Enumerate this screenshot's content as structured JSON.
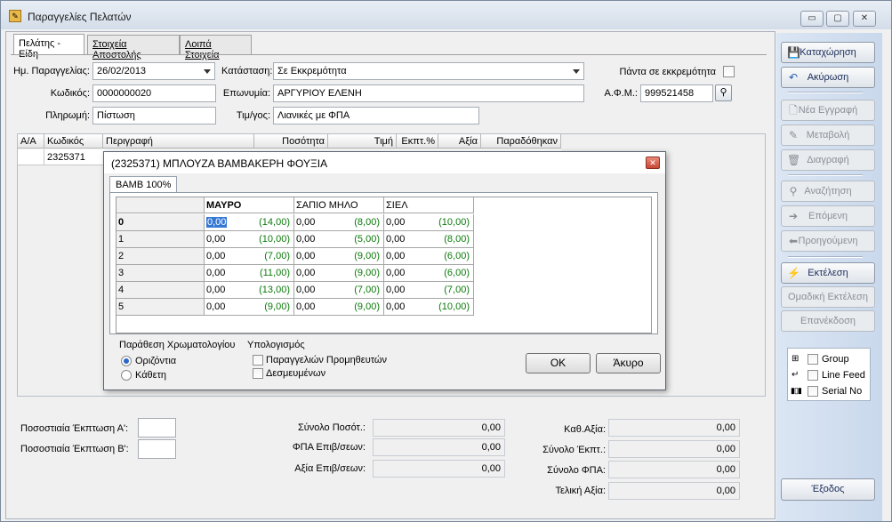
{
  "window": {
    "title": "Παραγγελίες Πελατών",
    "controls": [
      "▭",
      "▢",
      "✕"
    ]
  },
  "tabs": [
    {
      "label": "Πελάτης - Είδη"
    },
    {
      "label": "Στοιχεία Αποστολής"
    },
    {
      "label": "Λοιπά Στοιχεία"
    }
  ],
  "form": {
    "order_date_label": "Ημ. Παραγγελίας:",
    "order_date": "26/02/2013",
    "status_label": "Κατάσταση:",
    "status": "Σε Εκκρεμότητα",
    "always_pending_label": "Πάντα σε εκκρεμότητα",
    "code_label": "Κωδικός:",
    "code": "0000000020",
    "name_label": "Επωνυμία:",
    "name": "ΑΡΓΥΡΙΟΥ ΕΛΕΝΗ",
    "afm_label": "Α.Φ.Μ.:",
    "afm": "999521458",
    "payment_label": "Πληρωμή:",
    "payment": "Πίστωση",
    "pricelist_label": "Τιμ/γος:",
    "pricelist": "Λιανικές με ΦΠΑ"
  },
  "grid": {
    "columns": [
      "Α/Α",
      "Κωδικός",
      "Περιγραφή",
      "Ποσότητα",
      "Τιμή",
      "Εκπτ.%",
      "Αξία",
      "Παραδόθηκαν"
    ],
    "rows": [
      {
        "code": "2325371"
      }
    ]
  },
  "totals": {
    "disc_a_label": "Ποσοστιαία Έκπτωση  Α':",
    "disc_b_label": "Ποσοστιαία Έκπτωση  Β':",
    "sum_qty_label": "Σύνολο Ποσότ.:",
    "sum_qty": "0,00",
    "vat_charges_label": "ΦΠΑ Επιβ/σεων:",
    "vat_charges": "0,00",
    "value_charges_label": "Αξία Επιβ/σεων:",
    "value_charges": "0,00",
    "net_value_label": "Καθ.Αξία:",
    "net_value": "0,00",
    "sum_disc_label": "Σύνολο Έκπτ.:",
    "sum_disc": "0,00",
    "sum_vat_label": "Σύνολο ΦΠΑ:",
    "sum_vat": "0,00",
    "final_value_label": "Τελική Αξία:",
    "final_value": "0,00"
  },
  "sidebar": {
    "save": "Καταχώρηση",
    "cancel": "Ακύρωση",
    "new": "Νέα Εγγραφή",
    "edit": "Μεταβολή",
    "delete": "Διαγραφή",
    "search": "Αναζήτηση",
    "next": "Επόμενη",
    "prev": "Προηγούμενη",
    "execute": "Εκτέλεση",
    "group_execute": "Ομαδική Εκτέλεση",
    "reprint": "Επανέκδοση",
    "opt_group": "Group",
    "opt_linefeed": "Line Feed",
    "opt_serial": "Serial No",
    "exit": "Έξοδος"
  },
  "dialog": {
    "title": "(2325371) ΜΠΛΟΥΖΑ ΒΑΜΒΑΚΕΡΗ ΦΟΥΞΙΑ",
    "tab": "ΒΑΜΒ 100%",
    "colors": [
      "ΜΑΥΡΟ",
      "ΣΑΠΙΟ ΜΗΛΟ",
      "ΣΙΕΛ"
    ],
    "sizes": [
      "0",
      "1",
      "2",
      "3",
      "4",
      "5"
    ],
    "matrix": [
      [
        {
          "v": "0,00",
          "s": "(14,00)"
        },
        {
          "v": "0,00",
          "s": "(8,00)"
        },
        {
          "v": "0,00",
          "s": "(10,00)"
        }
      ],
      [
        {
          "v": "0,00",
          "s": "(10,00)"
        },
        {
          "v": "0,00",
          "s": "(5,00)"
        },
        {
          "v": "0,00",
          "s": "(8,00)"
        }
      ],
      [
        {
          "v": "0,00",
          "s": "(7,00)"
        },
        {
          "v": "0,00",
          "s": "(9,00)"
        },
        {
          "v": "0,00",
          "s": "(6,00)"
        }
      ],
      [
        {
          "v": "0,00",
          "s": "(11,00)"
        },
        {
          "v": "0,00",
          "s": "(9,00)"
        },
        {
          "v": "0,00",
          "s": "(6,00)"
        }
      ],
      [
        {
          "v": "0,00",
          "s": "(13,00)"
        },
        {
          "v": "0,00",
          "s": "(7,00)"
        },
        {
          "v": "0,00",
          "s": "(7,00)"
        }
      ],
      [
        {
          "v": "0,00",
          "s": "(9,00)"
        },
        {
          "v": "0,00",
          "s": "(9,00)"
        },
        {
          "v": "0,00",
          "s": "(10,00)"
        }
      ]
    ],
    "layout_label": "Παράθεση Χρωματολογίου",
    "horizontal": "Οριζόντια",
    "vertical": "Κάθετη",
    "calc_label": "Υπολογισμός",
    "calc_supplier": "Παραγγελιών Προμηθευτών",
    "calc_reserved": "Δεσμευμένων",
    "ok": "OK",
    "cancel": "Άκυρο"
  }
}
